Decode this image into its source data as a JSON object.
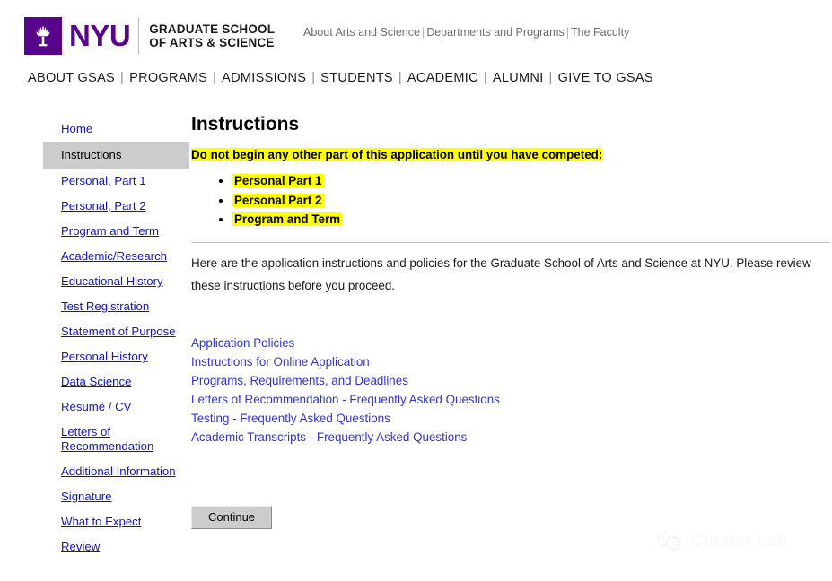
{
  "header": {
    "logo": {
      "icon": "nyu-torch-icon",
      "wordmark": "NYU",
      "school_line1": "GRADUATE SCHOOL",
      "school_line2": "OF ARTS & SCIENCE",
      "brand_color": "#57068c"
    },
    "utility_links": [
      "About Arts and Science",
      "Departments and Programs",
      "The Faculty"
    ],
    "separator": "|"
  },
  "main_nav": {
    "items": [
      "ABOUT GSAS",
      "PROGRAMS",
      "ADMISSIONS",
      "STUDENTS",
      "ACADEMIC",
      "ALUMNI",
      "GIVE TO GSAS"
    ],
    "separator": "|"
  },
  "sidebar": {
    "active_index": 1,
    "items": [
      "Home",
      "Instructions",
      "Personal, Part 1",
      "Personal, Part 2",
      "Program and Term",
      "Academic/Research",
      "Educational History",
      "Test Registration",
      "Statement of Purpose",
      "Personal History",
      "Data Science",
      "Résumé / CV",
      "Letters of Recommendation",
      "Additional Information",
      "Signature",
      "What to Expect",
      "Review"
    ]
  },
  "main": {
    "title": "Instructions",
    "warning": "Do not begin any other part of this application until you have competed:",
    "required_items": [
      "Personal Part 1",
      "Personal Part 2",
      "Program and Term"
    ],
    "intro_paragraph": "Here are the application instructions and policies for the Graduate School of Arts and Science at NYU. Please review these instructions before you proceed.",
    "resource_links": [
      "Application Policies",
      "Instructions for Online Application",
      "Programs, Requirements, and Deadlines",
      "Letters of Recommendation - Frequently Asked Questions",
      "Testing  - Frequently Asked Questions",
      "Academic Transcripts - Frequently Asked Questions"
    ],
    "continue_label": "Continue",
    "highlight_color": "#ffff00",
    "link_color": "#3333cc"
  },
  "watermark": {
    "icon": "wechat-icon",
    "text": "Curator Lab"
  }
}
